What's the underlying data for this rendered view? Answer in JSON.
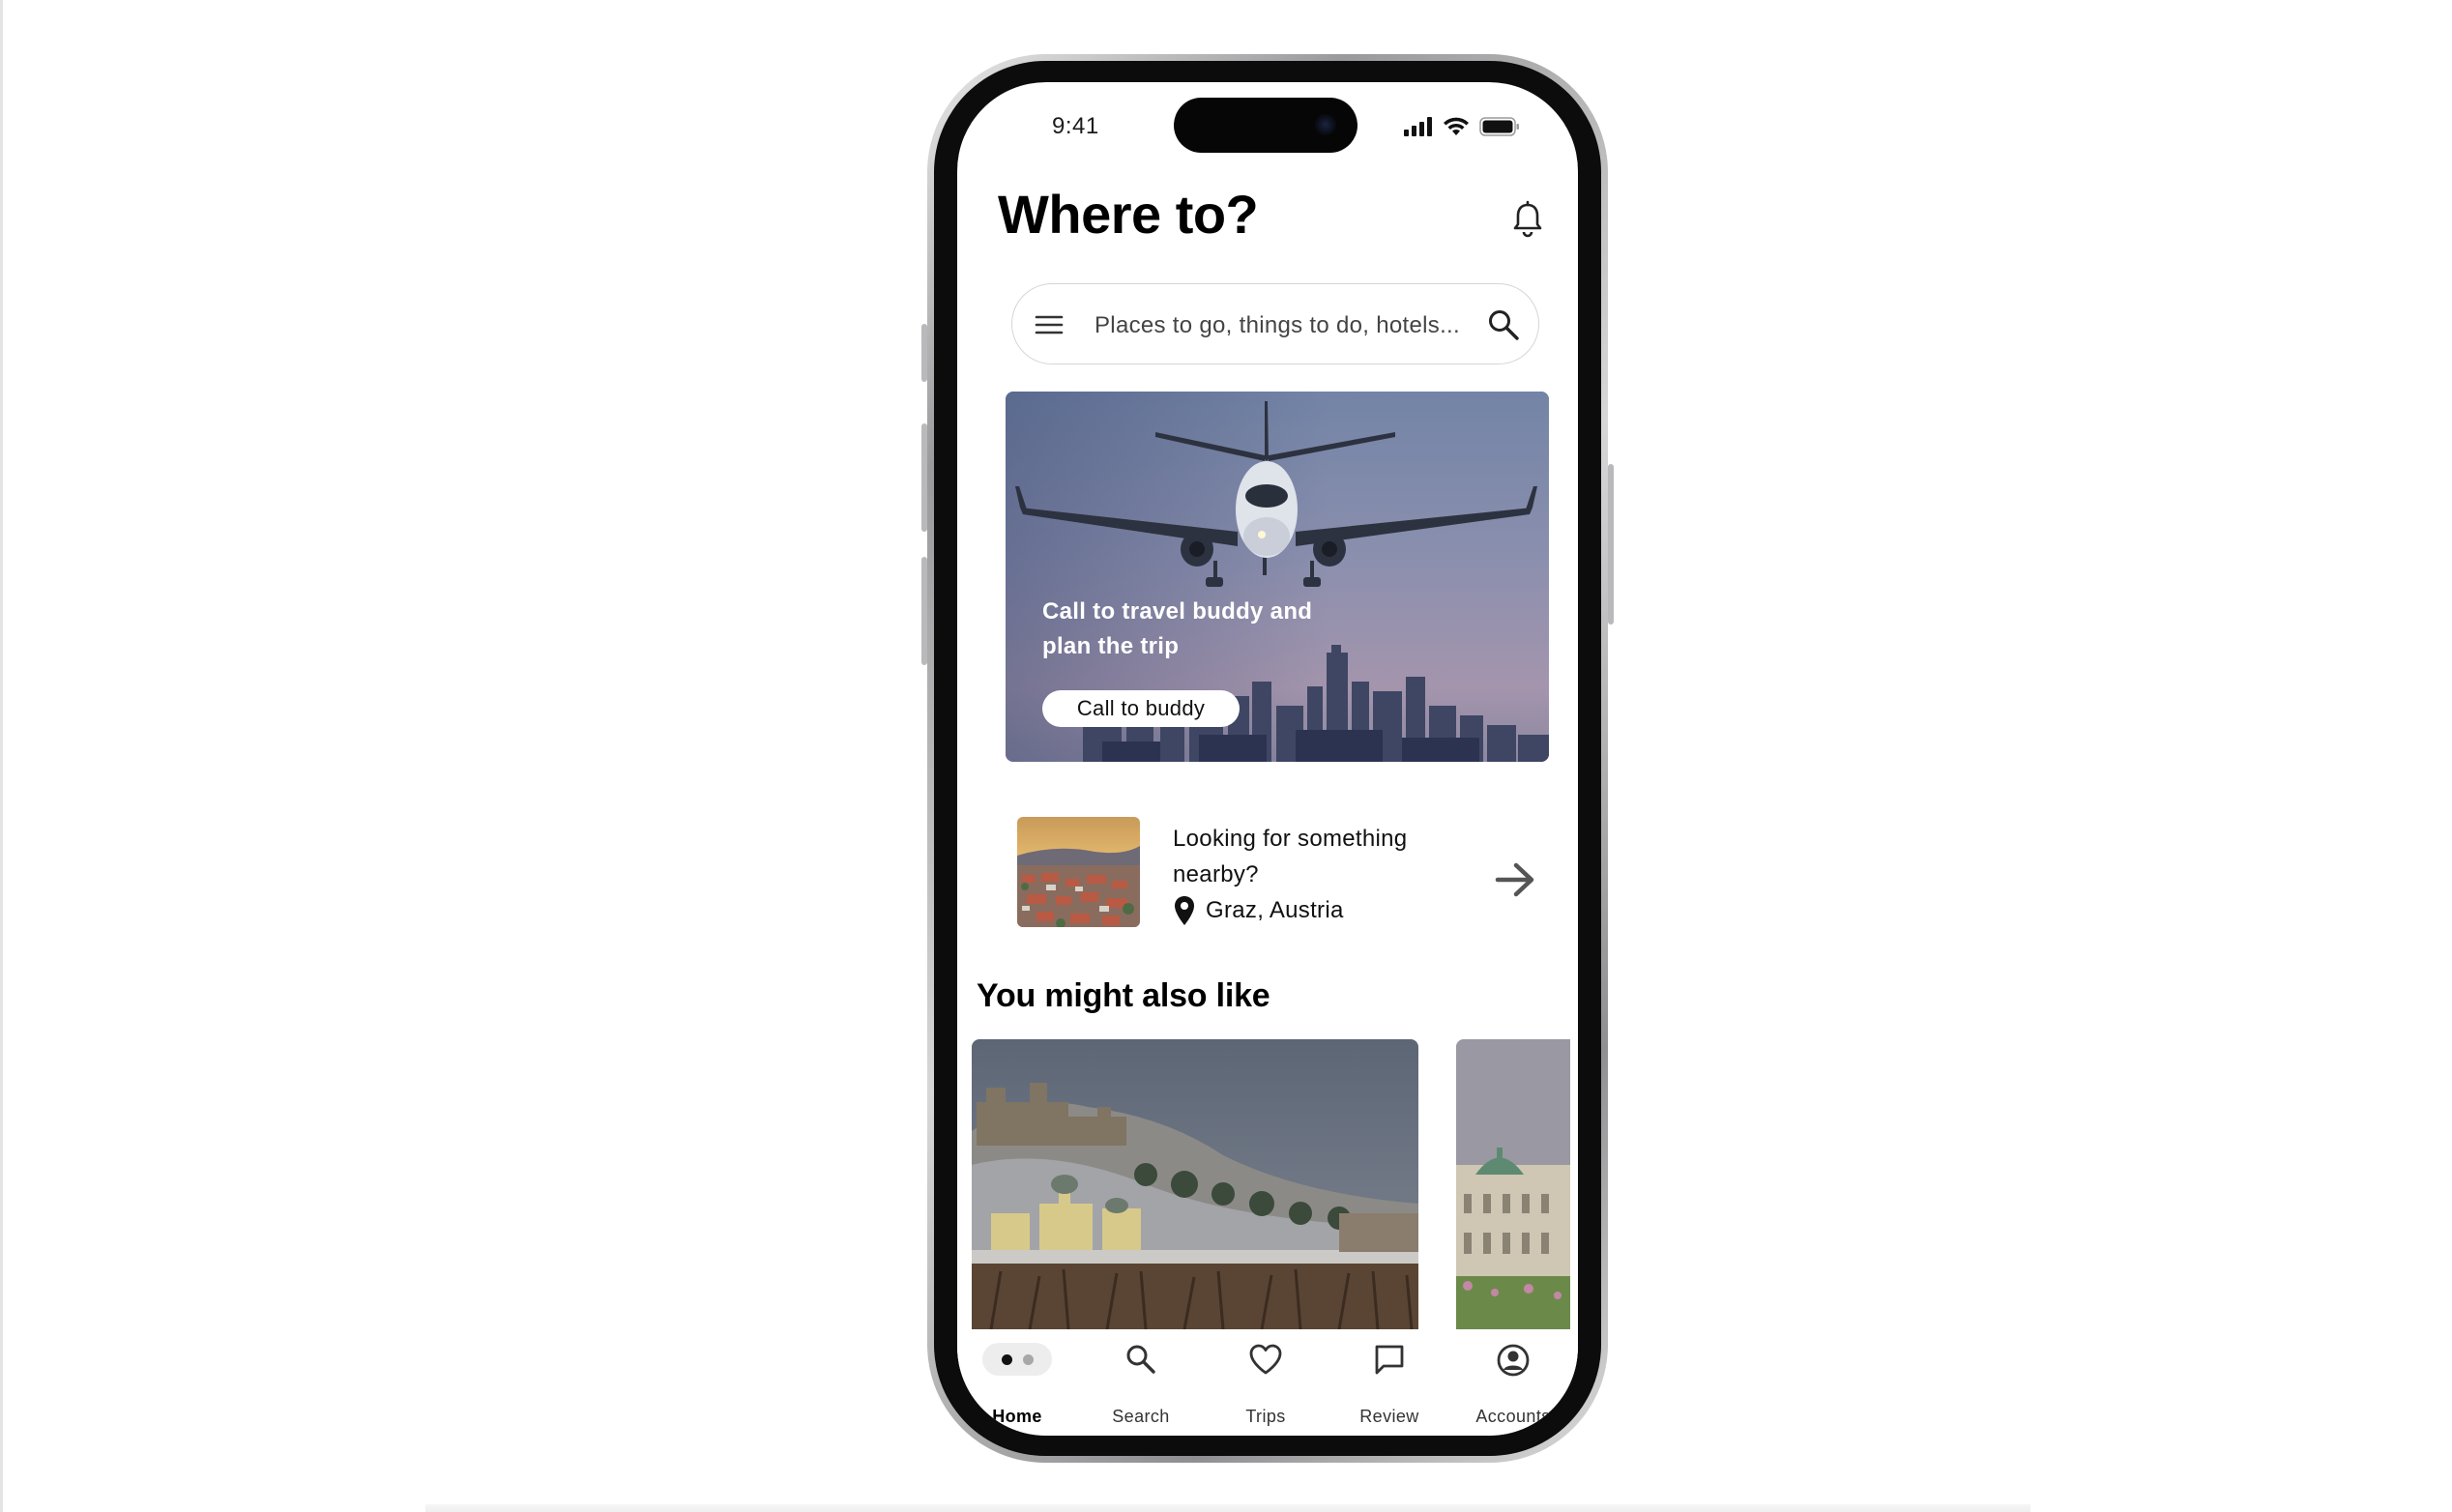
{
  "status_bar": {
    "time": "9:41"
  },
  "header": {
    "title": "Where to?"
  },
  "search": {
    "placeholder": "Places to go, things to do, hotels..."
  },
  "hero": {
    "text": "Call to travel buddy and plan the trip",
    "button_label": "Call to buddy"
  },
  "nearby": {
    "title": "Looking for something nearby?",
    "location": "Graz, Austria"
  },
  "section": {
    "title": "You might also like"
  },
  "bottom_nav": {
    "items": [
      {
        "label": "Home",
        "icon": "page-dots-icon",
        "active": true
      },
      {
        "label": "Search",
        "icon": "search-icon",
        "active": false
      },
      {
        "label": "Trips",
        "icon": "heart-icon",
        "active": false
      },
      {
        "label": "Review",
        "icon": "chat-bubble-icon",
        "active": false
      },
      {
        "label": "Accounts",
        "icon": "account-circle-icon",
        "active": false
      }
    ]
  },
  "colors": {
    "text": "#000000",
    "frame": "#0c0c0c",
    "pill": "#ededed"
  }
}
